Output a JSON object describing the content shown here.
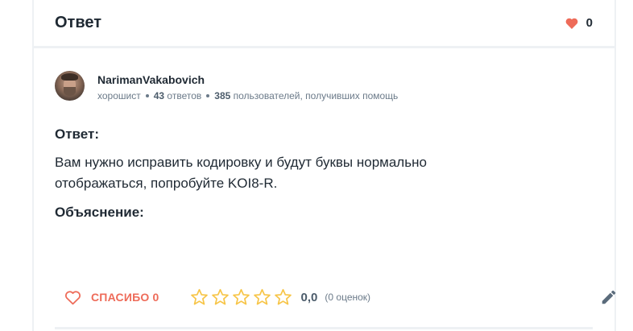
{
  "header": {
    "title": "Ответ",
    "likes_count": "0"
  },
  "author": {
    "name": "NarimanVakabovich",
    "rank": "хорошист",
    "answers_count": "43",
    "answers_label": "ответов",
    "helped_count": "385",
    "helped_label": "пользователей, получивших помощь"
  },
  "answer": {
    "label": "Ответ:",
    "text_line1": "Вам нужно исправить кодировку и будут буквы нормально",
    "text_line2": "отображаться, попробуйте KOI8-R.",
    "explanation_label": "Объяснение:"
  },
  "actions": {
    "thanks_label": "СПАСИБО 0",
    "stars_total": 5,
    "stars_filled": 0,
    "rating_value": "0,0",
    "rating_count": "(0 оценок)"
  },
  "colors": {
    "accent": "#ee6b59",
    "star": "#f7c548",
    "text": "#1f2933",
    "muted": "#6b7a89",
    "border": "#eef1f4",
    "edit_icon": "#5a6b7b"
  },
  "icons": {
    "like": "heart-icon",
    "thanks": "heart-outline-icon",
    "rating": "star-outline-icon",
    "edit": "pencil-icon"
  }
}
